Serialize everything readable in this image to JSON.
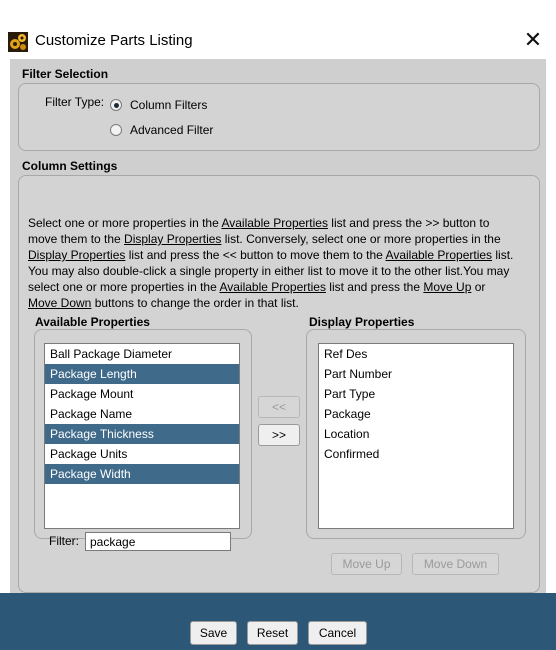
{
  "window": {
    "title": "Customize Parts Listing"
  },
  "filter_selection": {
    "title": "Filter Selection",
    "type_label": "Filter Type:",
    "options": [
      {
        "label": "Column Filters",
        "checked": true
      },
      {
        "label": "Advanced Filter",
        "checked": false
      }
    ]
  },
  "column_settings": {
    "title": "Column Settings",
    "description": {
      "p1": "Select one or more properties in the ",
      "l1": "Available Properties",
      "p2": " list and press the >> button to move them to the ",
      "l2": "Display Properties",
      "p3": " list. Conversely, select one or more properties in the ",
      "l3": "Display Properties",
      "p4": " list and press the << button to move them to the ",
      "l4": "Available Properties",
      "p5": " list. You may also double-click a single property in either list to move it to the other list.You may select one or more properties in the ",
      "l5": "Available Properties",
      "p6": " list and press the ",
      "l6": "Move Up",
      "p7": " or ",
      "l7": "Move Down",
      "p8": " buttons to change the order in that list."
    },
    "available": {
      "title": "Available Properties",
      "items": [
        {
          "label": "Ball Package Diameter",
          "selected": false
        },
        {
          "label": "Package Length",
          "selected": true
        },
        {
          "label": "Package Mount",
          "selected": false
        },
        {
          "label": "Package Name",
          "selected": false
        },
        {
          "label": "Package Thickness",
          "selected": true
        },
        {
          "label": "Package Units",
          "selected": false
        },
        {
          "label": "Package Width",
          "selected": true
        }
      ]
    },
    "display": {
      "title": "Display Properties",
      "items": [
        "Ref Des",
        "Part Number",
        "Part Type",
        "Package",
        "Location",
        "Confirmed"
      ]
    },
    "move_left_label": "<<",
    "move_right_label": ">>",
    "filter_label": "Filter:",
    "filter_value": "package",
    "move_up_label": "Move Up",
    "move_down_label": "Move Down"
  },
  "footer": {
    "save": "Save",
    "reset": "Reset",
    "cancel": "Cancel"
  },
  "colors": {
    "accent": "#2d5776",
    "selection": "#3f6a8a",
    "dialog_bg": "#cfcfcf"
  }
}
